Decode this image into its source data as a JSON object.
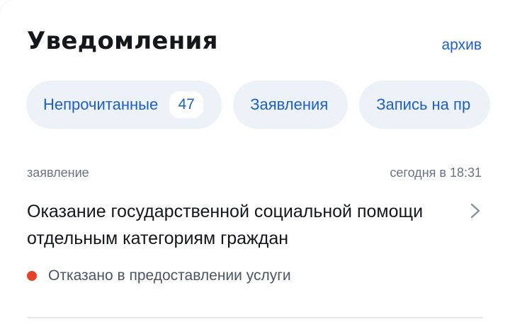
{
  "header": {
    "title": "Уведомления",
    "archive_label": "архив"
  },
  "filters": [
    {
      "label": "Непрочитанные",
      "count": "47"
    },
    {
      "label": "Заявления"
    },
    {
      "label": "Запись на пр"
    }
  ],
  "notification": {
    "type": "заявление",
    "time": "сегодня в 18:31",
    "title": "Оказание государственной социальной помощи отдельным категориям граждан",
    "status": "Отказано в предоставлении услуги"
  },
  "colors": {
    "accent": "#1d5fc9",
    "chip_background": "#edf2f8",
    "status_rejected": "#e8412c",
    "text_primary": "#15171c",
    "text_secondary": "#6b7280"
  },
  "icons": {
    "chevron": "chevron-right-icon",
    "status": "status-dot-icon"
  }
}
